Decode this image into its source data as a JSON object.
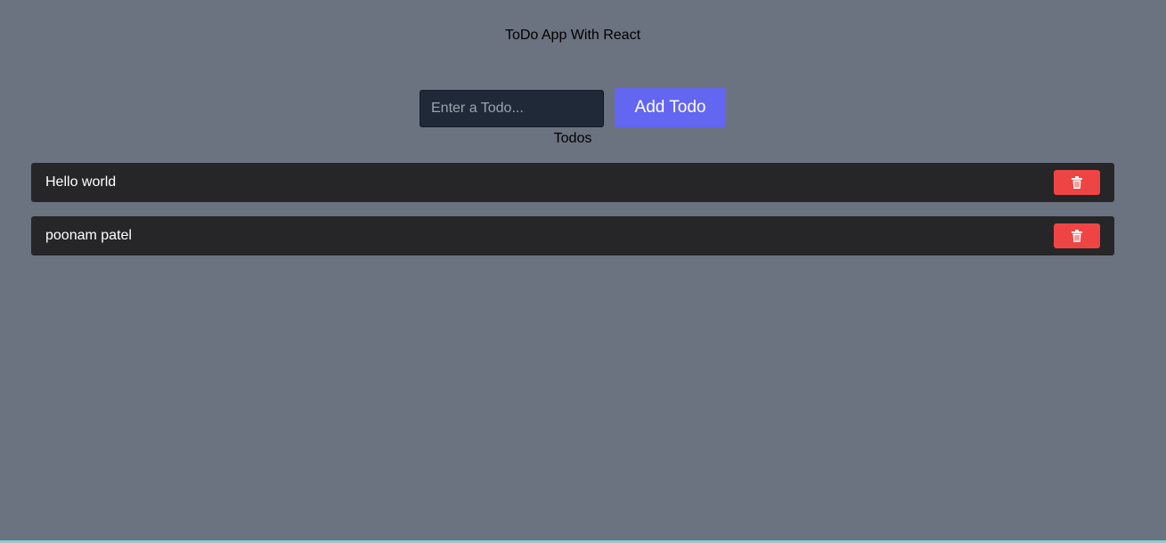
{
  "header": {
    "title": "ToDo App With React"
  },
  "form": {
    "input_placeholder": "Enter a Todo...",
    "input_value": "",
    "add_label": "Add Todo"
  },
  "list": {
    "heading": "Todos",
    "items": [
      {
        "text": "Hello world",
        "delete_icon": "trash-icon"
      },
      {
        "text": "poonam patel",
        "delete_icon": "trash-icon"
      }
    ]
  },
  "colors": {
    "background": "#6b7280",
    "item_background": "#262628",
    "accent": "#6366f1",
    "danger": "#ef4444",
    "input_background": "#1f2937"
  }
}
